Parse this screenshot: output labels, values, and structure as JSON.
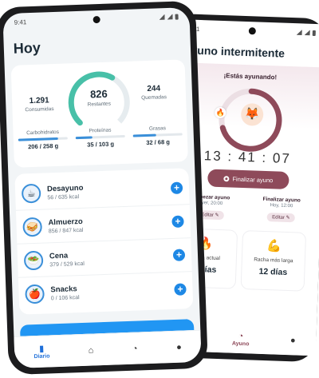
{
  "status": {
    "time": "9:41"
  },
  "diario": {
    "title": "Hoy",
    "summary": {
      "consumed": {
        "value": "1.291",
        "label": "Consumidas"
      },
      "remaining": {
        "value": "826",
        "label": "Restantes",
        "progress": 0.61
      },
      "burned": {
        "value": "244",
        "label": "Quemadas"
      }
    },
    "macros": [
      {
        "name": "Carbohidratos",
        "value": "206 / 258 g",
        "progress": 0.8
      },
      {
        "name": "Proteínas",
        "value": "35 / 103 g",
        "progress": 0.34
      },
      {
        "name": "Grasas",
        "value": "32 / 68 g",
        "progress": 0.47
      }
    ],
    "meals": [
      {
        "name": "Desayuno",
        "kcal": "56 / 635 kcal",
        "icon": "coffee-icon",
        "glyph": "☕"
      },
      {
        "name": "Almuerzo",
        "kcal": "856 / 847 kcal",
        "icon": "sandwich-icon",
        "glyph": "🥪"
      },
      {
        "name": "Cena",
        "kcal": "379 / 529 kcal",
        "icon": "salad-icon",
        "glyph": "🥗"
      },
      {
        "name": "Snacks",
        "kcal": "0 / 106 kcal",
        "icon": "apple-icon",
        "glyph": "🍎"
      }
    ],
    "add_glyph": "+",
    "nav": [
      {
        "label": "Diario",
        "icon": "book-icon",
        "glyph": "▮"
      },
      {
        "label": "",
        "icon": "chef-hat-icon",
        "glyph": "⌂"
      },
      {
        "label": "",
        "icon": "timer-icon",
        "glyph": "◔"
      },
      {
        "label": "",
        "icon": "profile-icon",
        "glyph": "●"
      }
    ]
  },
  "ayuno": {
    "title": "Ayuno intermitente",
    "fasting_label": "¡Estás ayunando!",
    "timer": "13 : 41 : 07",
    "progress": 0.7,
    "end_button": "Finalizar ayuno",
    "start": {
      "label": "Empezar ayuno",
      "value": "Ayer, 20:00",
      "edit": "Editar ✎"
    },
    "end": {
      "label": "Finalizar ayuno",
      "value": "Hoy, 12:00",
      "edit": "Editar ✎"
    },
    "streaks": [
      {
        "label": "Racha actual",
        "value": "4 días",
        "icon": "flame-icon",
        "glyph": "🔥"
      },
      {
        "label": "Racha más larga",
        "value": "12 días",
        "icon": "muscle-icon",
        "glyph": "💪"
      }
    ],
    "nav": [
      {
        "label": "",
        "icon": "chef-hat-icon",
        "glyph": "⌂"
      },
      {
        "label": "Ayuno",
        "icon": "timer-icon",
        "glyph": "◔"
      },
      {
        "label": "",
        "icon": "profile-icon",
        "glyph": "●"
      }
    ]
  },
  "colors": {
    "accent": "#1e88e5",
    "fasting": "#8e4a5a"
  }
}
